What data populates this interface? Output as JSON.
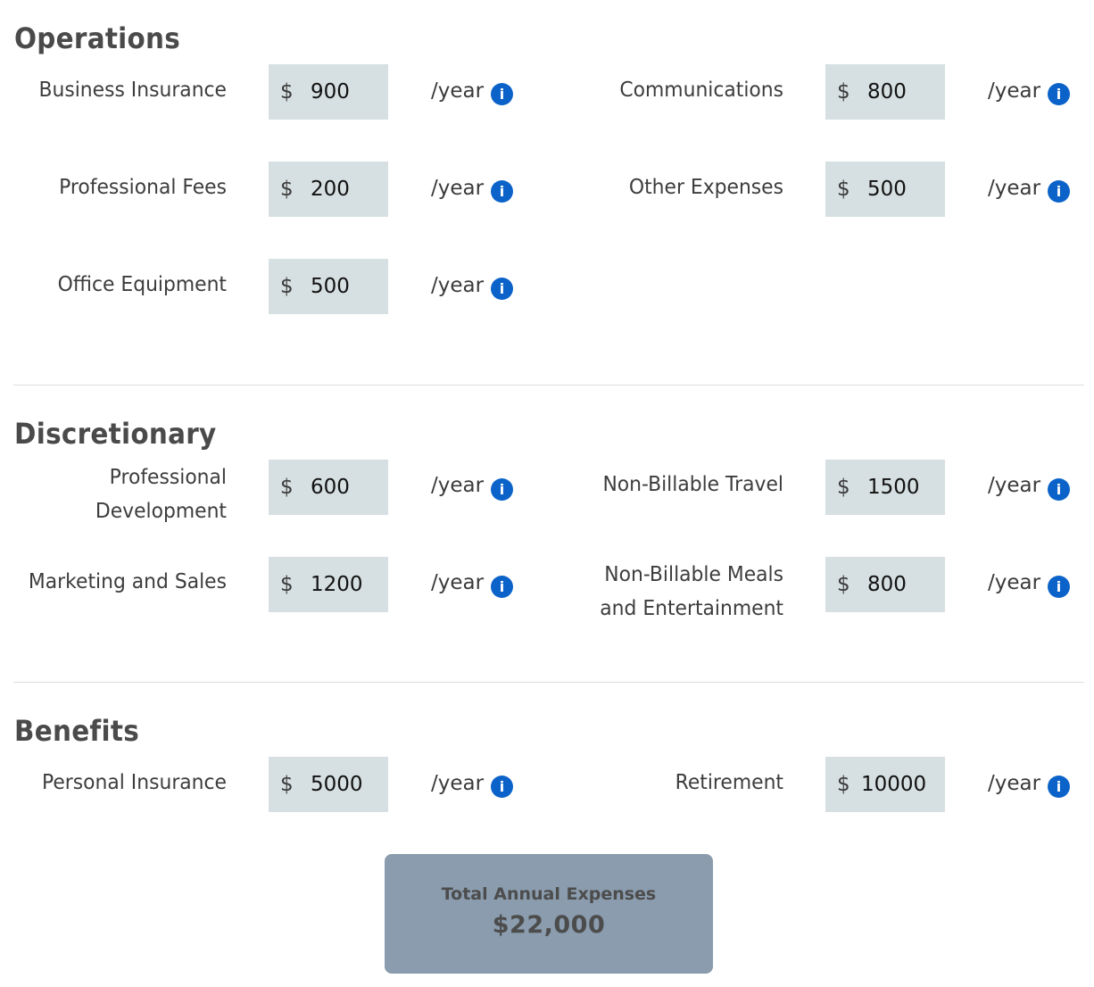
{
  "sections": [
    {
      "title": "Operations",
      "fields": [
        {
          "label": "Business Insurance",
          "currency": "$",
          "value": "900",
          "unit": "/year",
          "info": "i"
        },
        {
          "label": "Communications",
          "currency": "$",
          "value": "800",
          "unit": "/year",
          "info": "i"
        },
        {
          "label": "Professional Fees",
          "currency": "$",
          "value": "200",
          "unit": "/year",
          "info": "i"
        },
        {
          "label": "Other Expenses",
          "currency": "$",
          "value": "500",
          "unit": "/year",
          "info": "i"
        },
        {
          "label": "Office Equipment",
          "currency": "$",
          "value": "500",
          "unit": "/year",
          "info": "i"
        }
      ]
    },
    {
      "title": "Discretionary",
      "fields": [
        {
          "label_lines": [
            "Professional",
            "Development"
          ],
          "currency": "$",
          "value": "600",
          "unit": "/year",
          "info": "i"
        },
        {
          "label": "Non-Billable Travel",
          "currency": "$",
          "value": "1500",
          "unit": "/year",
          "info": "i"
        },
        {
          "label": "Marketing and Sales",
          "currency": "$",
          "value": "1200",
          "unit": "/year",
          "info": "i"
        },
        {
          "label_lines": [
            "Non-Billable Meals",
            "and Entertainment"
          ],
          "currency": "$",
          "value": "800",
          "unit": "/year",
          "info": "i"
        }
      ]
    },
    {
      "title": "Benefits",
      "fields": [
        {
          "label": "Personal Insurance",
          "currency": "$",
          "value": "5000",
          "unit": "/year",
          "info": "i"
        },
        {
          "label": "Retirement",
          "currency": "$",
          "value": "10000",
          "unit": "/year",
          "info": "i"
        }
      ]
    }
  ],
  "total": {
    "label": "Total Annual Expenses",
    "value": "$22,000"
  },
  "colors": {
    "input_bg": "#d6dfe1",
    "info_icon": "#0b63c9",
    "total_bg": "#8a9cad"
  }
}
